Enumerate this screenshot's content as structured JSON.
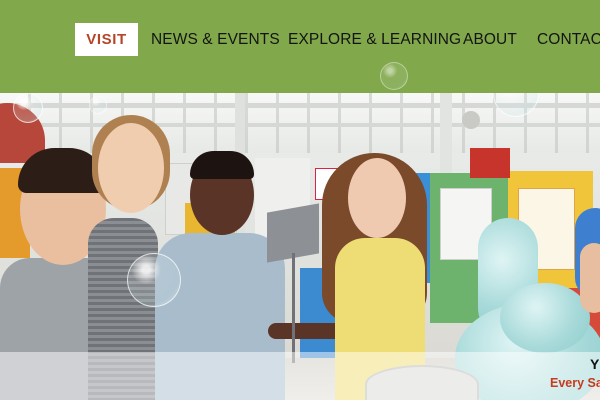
{
  "nav": {
    "visit": "VISIT",
    "news_events": "NEWS & EVENTS",
    "explore_learning": "EXPLORE & LEARNING",
    "about": "ABOUT",
    "contact": "CONTACT"
  },
  "hero": {
    "banner_title": "Y",
    "banner_subtitle": "Every Sa"
  },
  "colors": {
    "header_bg": "#81a84a",
    "visit_text": "#b54526",
    "banner_subtitle": "#c83a1e"
  }
}
